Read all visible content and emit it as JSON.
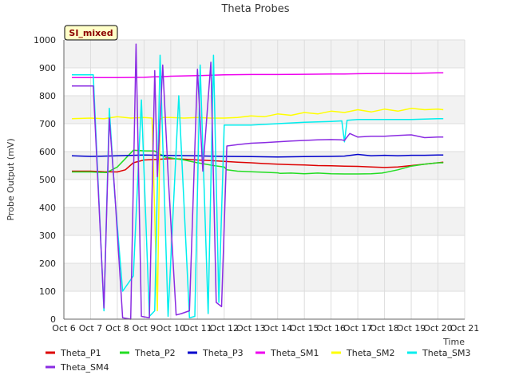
{
  "chart_data": {
    "type": "line",
    "title": "Theta Probes",
    "xlabel": "Time",
    "ylabel": "Probe Output (mV)",
    "badge": "SI_mixed",
    "xlim": [
      6,
      21
    ],
    "ylim": [
      0,
      1000
    ],
    "x_ticks": [
      6,
      7,
      8,
      9,
      10,
      11,
      12,
      13,
      14,
      15,
      16,
      17,
      18,
      19,
      20,
      21
    ],
    "x_tick_labels": [
      "Oct 6",
      "Oct 7",
      "Oct 8",
      "Oct 9",
      "Oct 10",
      "Oct 11",
      "Oct 12",
      "Oct 13",
      "Oct 14",
      "Oct 15",
      "Oct 16",
      "Oct 17",
      "Oct 18",
      "Oct 19",
      "Oct 20",
      "Oct 21"
    ],
    "y_ticks": [
      0,
      100,
      200,
      300,
      400,
      500,
      600,
      700,
      800,
      900,
      1000
    ],
    "y_tick_labels": [
      "0",
      "100",
      "200",
      "300",
      "400",
      "500",
      "600",
      "700",
      "800",
      "900",
      "1000"
    ],
    "grid": true,
    "legend_position": "bottom",
    "series": [
      {
        "name": "Theta_P1",
        "color": "#dd0000",
        "x": [
          6.3,
          7,
          7.5,
          8,
          8.3,
          8.6,
          9,
          9.5,
          10,
          10.5,
          11,
          11.5,
          12,
          12.5,
          13,
          13.5,
          14,
          14.5,
          15,
          15.5,
          16,
          16.5,
          17,
          17.5,
          18,
          18.5,
          19,
          19.5,
          20,
          20.2
        ],
        "y": [
          530,
          530,
          528,
          527,
          535,
          560,
          570,
          572,
          575,
          573,
          570,
          568,
          565,
          562,
          560,
          557,
          555,
          553,
          552,
          550,
          549,
          548,
          547,
          545,
          543,
          545,
          550,
          555,
          560,
          562
        ]
      },
      {
        "name": "Theta_P2",
        "color": "#22dd22",
        "x": [
          6.3,
          7,
          7.6,
          8.0,
          8.3,
          8.6,
          9.0,
          9.4,
          9.8,
          10.5,
          11.0,
          11.3,
          11.6,
          12.0,
          12.1,
          12.5,
          13.0,
          13.5,
          14.0,
          14.1,
          14.5,
          15.0,
          15.5,
          16.0,
          16.5,
          17.0,
          17.5,
          17.9,
          18.0,
          18.5,
          19.0,
          19.5,
          20.0,
          20.2
        ],
        "y": [
          527,
          527,
          525,
          545,
          575,
          605,
          603,
          602,
          580,
          570,
          560,
          555,
          550,
          545,
          535,
          530,
          528,
          526,
          524,
          522,
          523,
          521,
          523,
          521,
          520,
          520,
          521,
          523,
          525,
          535,
          548,
          555,
          560,
          560
        ]
      },
      {
        "name": "Theta_P3",
        "color": "#0000cc",
        "x": [
          6.3,
          7,
          8,
          9,
          10,
          11,
          12,
          13,
          14,
          15,
          16,
          16.5,
          17,
          17.5,
          18,
          18.5,
          19,
          19.5,
          20,
          20.2
        ],
        "y": [
          585,
          583,
          585,
          588,
          586,
          585,
          583,
          582,
          581,
          582,
          583,
          584,
          590,
          585,
          587,
          585,
          587,
          587,
          588,
          588
        ]
      },
      {
        "name": "Theta_SM1",
        "color": "#ee00ee",
        "x": [
          6.3,
          7,
          8,
          9,
          9.4,
          9.5,
          9.6,
          10,
          11,
          12,
          13,
          14,
          15,
          16,
          16.5,
          17,
          18,
          19,
          20,
          20.2
        ],
        "y": [
          865,
          865,
          865,
          866,
          868,
          868,
          868,
          870,
          872,
          875,
          876,
          876,
          877,
          878,
          878,
          879,
          880,
          880,
          882,
          882
        ]
      },
      {
        "name": "Theta_SM2",
        "color": "#ffff00",
        "x": [
          6.3,
          7,
          7.5,
          8,
          8.5,
          9,
          9.3,
          9.5,
          9.6,
          9.7,
          10,
          10.5,
          11,
          11.5,
          12,
          12.5,
          13,
          13.5,
          14,
          14.5,
          15,
          15.5,
          16,
          16.5,
          17,
          17.5,
          18,
          18.5,
          19,
          19.5,
          20,
          20.2
        ],
        "y": [
          718,
          720,
          718,
          725,
          720,
          722,
          720,
          30,
          715,
          722,
          722,
          720,
          722,
          720,
          720,
          722,
          728,
          725,
          735,
          730,
          740,
          735,
          745,
          740,
          750,
          742,
          752,
          745,
          755,
          750,
          752,
          750
        ]
      },
      {
        "name": "Theta_SM3",
        "color": "#00eeee",
        "x": [
          6.3,
          7.1,
          7.5,
          7.7,
          7.9,
          8.2,
          8.6,
          8.9,
          9.2,
          9.4,
          9.6,
          9.9,
          10.3,
          10.7,
          10.9,
          11.1,
          11.4,
          11.6,
          11.8,
          12.0,
          13,
          14,
          15,
          16,
          16.4,
          16.5,
          16.6,
          17,
          18,
          19,
          20,
          20.2
        ],
        "y": [
          875,
          875,
          30,
          755,
          450,
          100,
          155,
          785,
          10,
          30,
          945,
          10,
          800,
          5,
          10,
          910,
          20,
          945,
          60,
          695,
          695,
          700,
          705,
          708,
          710,
          635,
          712,
          715,
          715,
          715,
          718,
          718
        ]
      },
      {
        "name": "Theta_SM4",
        "color": "#8a2be2",
        "x": [
          6.3,
          7.1,
          7.5,
          7.7,
          7.9,
          8.2,
          8.5,
          8.7,
          8.9,
          9.2,
          9.4,
          9.5,
          9.7,
          9.9,
          10.2,
          10.4,
          10.7,
          11.0,
          11.2,
          11.5,
          11.7,
          11.9,
          12.1,
          12.5,
          13,
          13.5,
          14,
          14.5,
          15,
          15.5,
          16,
          16.4,
          16.5,
          16.7,
          17,
          17.5,
          18,
          18.5,
          19,
          19.5,
          20,
          20.2
        ],
        "y": [
          835,
          835,
          40,
          720,
          460,
          5,
          0,
          985,
          10,
          5,
          890,
          510,
          910,
          520,
          15,
          20,
          30,
          895,
          530,
          920,
          60,
          45,
          620,
          625,
          630,
          632,
          635,
          638,
          640,
          642,
          643,
          642,
          640,
          665,
          652,
          655,
          655,
          658,
          660,
          650,
          652,
          652
        ]
      }
    ]
  }
}
